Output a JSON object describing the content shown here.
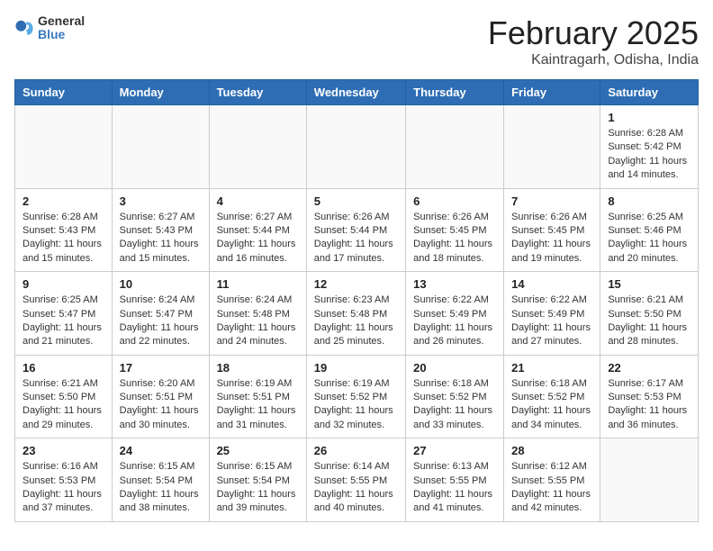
{
  "header": {
    "logo_general": "General",
    "logo_blue": "Blue",
    "month_title": "February 2025",
    "location": "Kaintragarh, Odisha, India"
  },
  "days_of_week": [
    "Sunday",
    "Monday",
    "Tuesday",
    "Wednesday",
    "Thursday",
    "Friday",
    "Saturday"
  ],
  "weeks": [
    [
      {
        "day": "",
        "info": ""
      },
      {
        "day": "",
        "info": ""
      },
      {
        "day": "",
        "info": ""
      },
      {
        "day": "",
        "info": ""
      },
      {
        "day": "",
        "info": ""
      },
      {
        "day": "",
        "info": ""
      },
      {
        "day": "1",
        "info": "Sunrise: 6:28 AM\nSunset: 5:42 PM\nDaylight: 11 hours and 14 minutes."
      }
    ],
    [
      {
        "day": "2",
        "info": "Sunrise: 6:28 AM\nSunset: 5:43 PM\nDaylight: 11 hours and 15 minutes."
      },
      {
        "day": "3",
        "info": "Sunrise: 6:27 AM\nSunset: 5:43 PM\nDaylight: 11 hours and 15 minutes."
      },
      {
        "day": "4",
        "info": "Sunrise: 6:27 AM\nSunset: 5:44 PM\nDaylight: 11 hours and 16 minutes."
      },
      {
        "day": "5",
        "info": "Sunrise: 6:26 AM\nSunset: 5:44 PM\nDaylight: 11 hours and 17 minutes."
      },
      {
        "day": "6",
        "info": "Sunrise: 6:26 AM\nSunset: 5:45 PM\nDaylight: 11 hours and 18 minutes."
      },
      {
        "day": "7",
        "info": "Sunrise: 6:26 AM\nSunset: 5:45 PM\nDaylight: 11 hours and 19 minutes."
      },
      {
        "day": "8",
        "info": "Sunrise: 6:25 AM\nSunset: 5:46 PM\nDaylight: 11 hours and 20 minutes."
      }
    ],
    [
      {
        "day": "9",
        "info": "Sunrise: 6:25 AM\nSunset: 5:47 PM\nDaylight: 11 hours and 21 minutes."
      },
      {
        "day": "10",
        "info": "Sunrise: 6:24 AM\nSunset: 5:47 PM\nDaylight: 11 hours and 22 minutes."
      },
      {
        "day": "11",
        "info": "Sunrise: 6:24 AM\nSunset: 5:48 PM\nDaylight: 11 hours and 24 minutes."
      },
      {
        "day": "12",
        "info": "Sunrise: 6:23 AM\nSunset: 5:48 PM\nDaylight: 11 hours and 25 minutes."
      },
      {
        "day": "13",
        "info": "Sunrise: 6:22 AM\nSunset: 5:49 PM\nDaylight: 11 hours and 26 minutes."
      },
      {
        "day": "14",
        "info": "Sunrise: 6:22 AM\nSunset: 5:49 PM\nDaylight: 11 hours and 27 minutes."
      },
      {
        "day": "15",
        "info": "Sunrise: 6:21 AM\nSunset: 5:50 PM\nDaylight: 11 hours and 28 minutes."
      }
    ],
    [
      {
        "day": "16",
        "info": "Sunrise: 6:21 AM\nSunset: 5:50 PM\nDaylight: 11 hours and 29 minutes."
      },
      {
        "day": "17",
        "info": "Sunrise: 6:20 AM\nSunset: 5:51 PM\nDaylight: 11 hours and 30 minutes."
      },
      {
        "day": "18",
        "info": "Sunrise: 6:19 AM\nSunset: 5:51 PM\nDaylight: 11 hours and 31 minutes."
      },
      {
        "day": "19",
        "info": "Sunrise: 6:19 AM\nSunset: 5:52 PM\nDaylight: 11 hours and 32 minutes."
      },
      {
        "day": "20",
        "info": "Sunrise: 6:18 AM\nSunset: 5:52 PM\nDaylight: 11 hours and 33 minutes."
      },
      {
        "day": "21",
        "info": "Sunrise: 6:18 AM\nSunset: 5:52 PM\nDaylight: 11 hours and 34 minutes."
      },
      {
        "day": "22",
        "info": "Sunrise: 6:17 AM\nSunset: 5:53 PM\nDaylight: 11 hours and 36 minutes."
      }
    ],
    [
      {
        "day": "23",
        "info": "Sunrise: 6:16 AM\nSunset: 5:53 PM\nDaylight: 11 hours and 37 minutes."
      },
      {
        "day": "24",
        "info": "Sunrise: 6:15 AM\nSunset: 5:54 PM\nDaylight: 11 hours and 38 minutes."
      },
      {
        "day": "25",
        "info": "Sunrise: 6:15 AM\nSunset: 5:54 PM\nDaylight: 11 hours and 39 minutes."
      },
      {
        "day": "26",
        "info": "Sunrise: 6:14 AM\nSunset: 5:55 PM\nDaylight: 11 hours and 40 minutes."
      },
      {
        "day": "27",
        "info": "Sunrise: 6:13 AM\nSunset: 5:55 PM\nDaylight: 11 hours and 41 minutes."
      },
      {
        "day": "28",
        "info": "Sunrise: 6:12 AM\nSunset: 5:55 PM\nDaylight: 11 hours and 42 minutes."
      },
      {
        "day": "",
        "info": ""
      }
    ]
  ]
}
